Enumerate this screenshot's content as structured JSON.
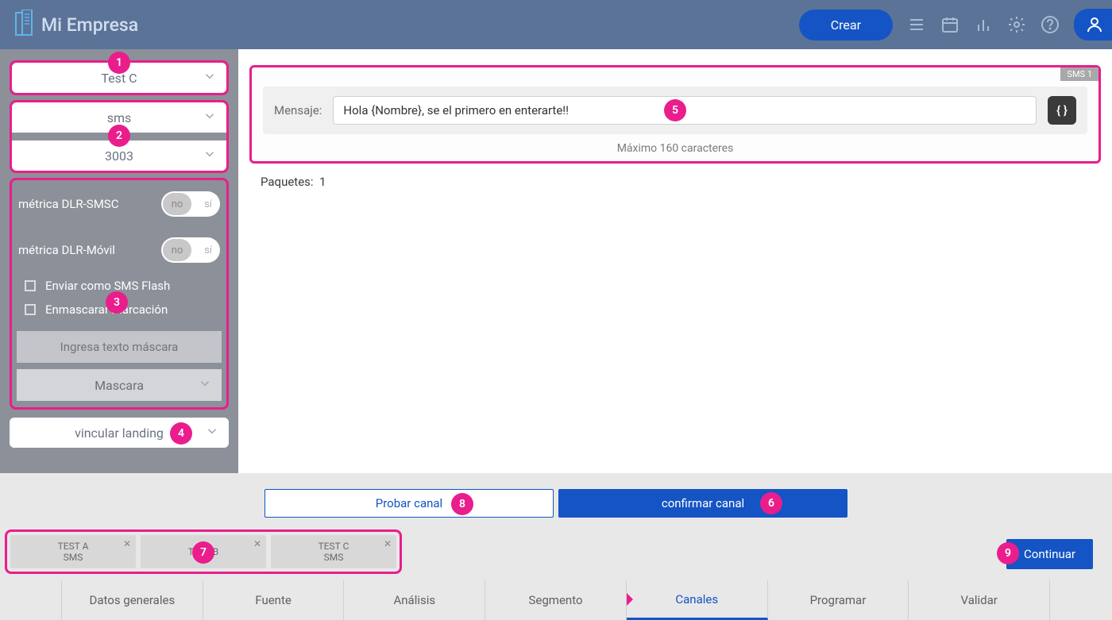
{
  "header": {
    "company_name": "Mi Empresa",
    "create_button": "Crear"
  },
  "sidebar": {
    "select_test": "Test C",
    "select_channel": "sms",
    "select_number": "3003",
    "metric_smsc_label": "métrica DLR-SMSC",
    "metric_movil_label": "métrica DLR-Móvil",
    "toggle_no": "no",
    "toggle_si": "sí",
    "checkbox_flash": "Enviar como SMS Flash",
    "checkbox_mask": "Enmascarar marcación",
    "mask_placeholder": "Ingresa texto máscara",
    "mask_select": "Mascara",
    "link_landing": "vincular landing"
  },
  "message": {
    "badge": "SMS 1",
    "label": "Mensaje:",
    "value": "Hola {Nombre}, se el primero en enterarte!!",
    "max_chars": "Máximo 160 caracteres",
    "brace_icon": "{ }"
  },
  "packets": {
    "label": "Paquetes:",
    "count": "1"
  },
  "actions": {
    "probar": "Probar canal",
    "confirmar": "confirmar canal",
    "continuar": "Continuar"
  },
  "tabs": [
    {
      "name": "TEST A",
      "type": "SMS"
    },
    {
      "name": "TEST B",
      "type": ""
    },
    {
      "name": "TEST C",
      "type": "SMS"
    }
  ],
  "steps": [
    "Datos generales",
    "Fuente",
    "Análisis",
    "Segmento",
    "Canales",
    "Programar",
    "Validar"
  ],
  "annotations": {
    "1": "1",
    "2": "2",
    "3": "3",
    "4": "4",
    "5": "5",
    "6": "6",
    "7": "7",
    "8": "8",
    "9": "9"
  }
}
